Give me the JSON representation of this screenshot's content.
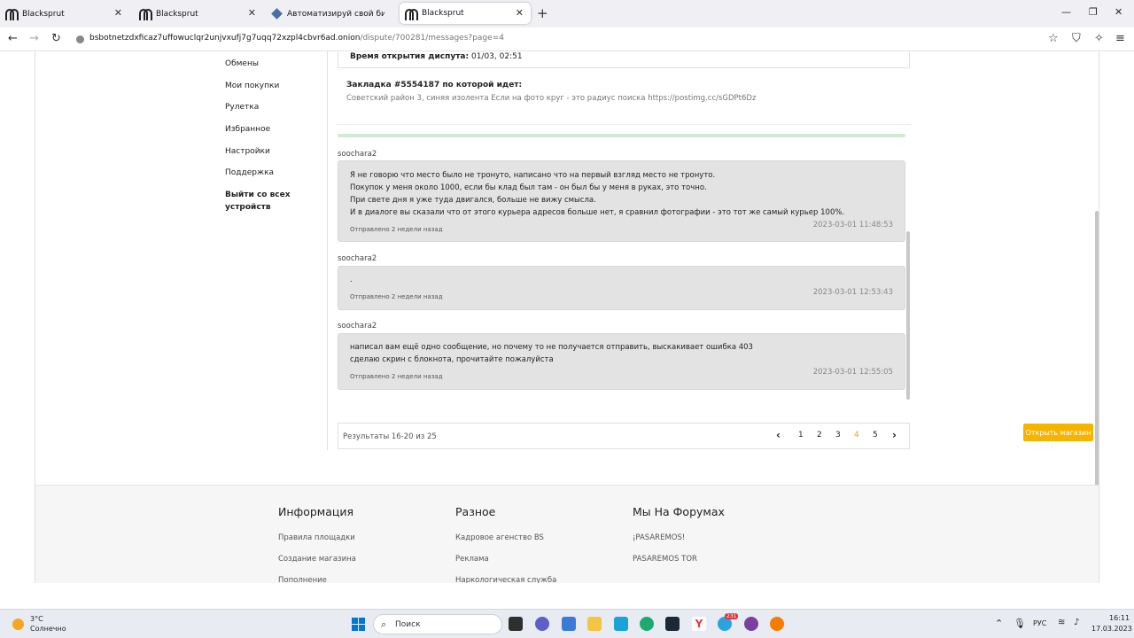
{
  "browser": {
    "tabs": [
      {
        "label": "Blacksprut",
        "icon": "blacksprut-logo"
      },
      {
        "label": "Blacksprut",
        "icon": "blacksprut-logo"
      },
      {
        "label": "Автоматизируй свой бизнес с",
        "icon": "diamond-logo"
      },
      {
        "label": "Blacksprut",
        "icon": "blacksprut-logo"
      }
    ],
    "url_host": "bsbotnetzdxficaz7uffowuclqr2unjvxufj7g7uqq72xzpl4cbvr6ad.onion",
    "url_path": "/dispute/700281/messages?page=4"
  },
  "sidebar": {
    "items": [
      "Обмены",
      "Мои покупки",
      "Рулетка",
      "Избранное",
      "Настройки",
      "Поддержка"
    ],
    "logout_line1": "Выйти со всех",
    "logout_line2": "устройств"
  },
  "dispute": {
    "opened_label": "Время открытия диспута:",
    "opened_value": "01/03, 02:51",
    "bookmark_title": "Закладка #5554187 по которой идет:",
    "bookmark_text": "Советский район 3, синяя изолента Если на фото круг - это радиус поиска https://postimg.cc/sGDPt6Dz"
  },
  "messages": [
    {
      "author": "soochara2",
      "lines": [
        "Я не говорю что место было не тронуто, написано что на первый взгляд место не тронуто.",
        "Покупок у меня около 1000, если бы клад был там - он был бы у меня в руках, это точно.",
        "При свете дня я уже туда двигался, больше не вижу смысла.",
        "И в диалоге вы сказали что от этого курьера адресов больше нет, я сравнил фотографии - это тот же самый курьер 100%."
      ],
      "timestamp": "2023-03-01 11:48:53",
      "sent": "Отправлено 2 недели назад"
    },
    {
      "author": "soochara2",
      "lines": [
        "."
      ],
      "timestamp": "2023-03-01 12:53:43",
      "sent": "Отправлено 2 недели назад"
    },
    {
      "author": "soochara2",
      "lines": [
        "написал вам ещё одно сообщение, но почему то не получается отправить, выскакивает ошибка 403",
        "сделаю скрин с блокнота, прочитайте пожалуйста"
      ],
      "timestamp": "2023-03-01 12:55:05",
      "sent": "Отправлено 2 недели назад"
    }
  ],
  "pagination": {
    "results": "Результаты 16-20 из 25",
    "pages": [
      "1",
      "2",
      "3",
      "4",
      "5"
    ],
    "current": "4"
  },
  "open_shop_button": "Открыть магазин",
  "footer": {
    "col1": {
      "title": "Информация",
      "links": [
        "Правила площадки",
        "Создание магазина",
        "Пополнение"
      ]
    },
    "col2": {
      "title": "Разное",
      "links": [
        "Кадровое агенство BS",
        "Реклама",
        "Наркологическая служба"
      ]
    },
    "col3": {
      "title": "Мы На Форумах",
      "links": [
        "¡PASAREMOS!",
        "PASAREMOS TOR"
      ]
    }
  },
  "taskbar": {
    "weather_temp": "3°C",
    "weather_desc": "Солнечно",
    "search_label": "Поиск",
    "lang": "РУС",
    "time": "16:11",
    "date": "17.03.2023",
    "badge_count": "231"
  },
  "colors": {
    "accent_orange": "#f5b400",
    "current_page": "#f0a41c",
    "message_bg": "#e3e3e4"
  }
}
